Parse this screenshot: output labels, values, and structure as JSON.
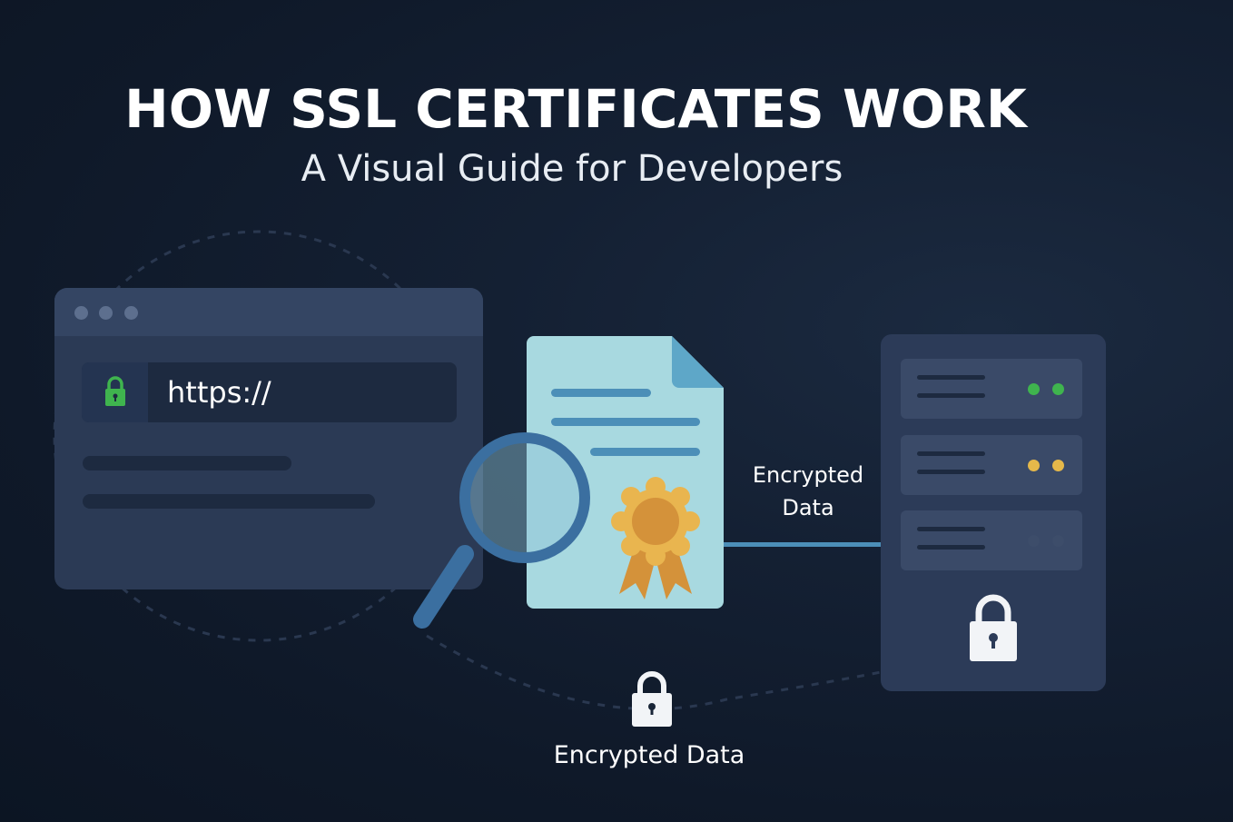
{
  "header": {
    "title": "HOW SSL CERTIFICATES WORK",
    "subtitle": "A Visual Guide for Developers"
  },
  "browser": {
    "url": "https://",
    "lock_icon": "lock-icon-green"
  },
  "certificate": {
    "icon": "document-icon",
    "badge_icon": "award-ribbon-icon",
    "magnifier_icon": "magnifying-glass-icon"
  },
  "connection": {
    "label_middle": "Encrypted Data",
    "label_bottom": "Encrypted Data"
  },
  "server": {
    "icon": "server-rack-icon",
    "led_colors": [
      [
        "#3fb44e",
        "#3fb44e"
      ],
      [
        "#e5b84a",
        "#e5b84a"
      ],
      [
        "#3d4d6a",
        "#3d4d6a"
      ]
    ],
    "lock_icon": "padlock-icon"
  },
  "colors": {
    "background": "#0f1929",
    "panel": "#2b3a55",
    "accent_blue": "#4c8fb8",
    "certificate_paper": "#a8d9e0",
    "badge_gold": "#e3a444",
    "lock_green": "#3fb44e"
  }
}
